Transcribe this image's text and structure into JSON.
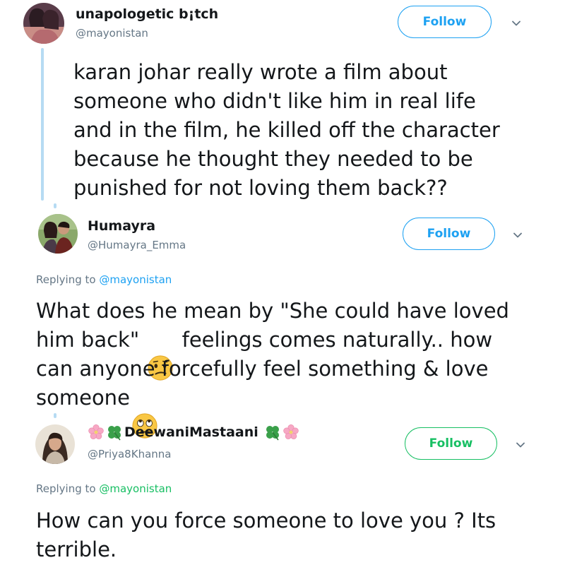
{
  "tweets": [
    {
      "name": "unapologetic b¡tch",
      "handle": "@mayonistan",
      "follow_label": "Follow",
      "text": "karan johar really wrote a film about\nsomeone who didn't like him in real life\nand in the film, he killed off the character\nbecause he thought they needed to be\npunished for not loving them back??"
    },
    {
      "name": "Humayra",
      "handle": "@Humayra_Emma",
      "follow_label": "Follow",
      "replying_prefix": "Replying to",
      "replying_to": "@mayonistan",
      "text_part1": "What does he mean by \"She could have loved\nhim back\"",
      "text_part2": "feelings comes naturally.. how\ncan anyone forcefully feel something & love\nsomeone"
    },
    {
      "name": "DeewaniMastaani",
      "handle": "@Priya8Khanna",
      "follow_label": "Follow",
      "replying_prefix": "Replying to",
      "replying_to": "@mayonistan",
      "text": "How can you force someone to love you ? Its\nterrible."
    }
  ],
  "icons": {
    "confused_emoji": "confused-face",
    "eye_roll_emoji": "face-with-rolling-eyes",
    "decorations": [
      "cherry-blossom",
      "four-leaf-clover"
    ],
    "menu": "chevron-down"
  },
  "colors": {
    "follow_blue": "#1da1f2",
    "follow_green": "#17bf63",
    "thread_line": "#b6dbf3",
    "handle_gray": "#657786"
  }
}
